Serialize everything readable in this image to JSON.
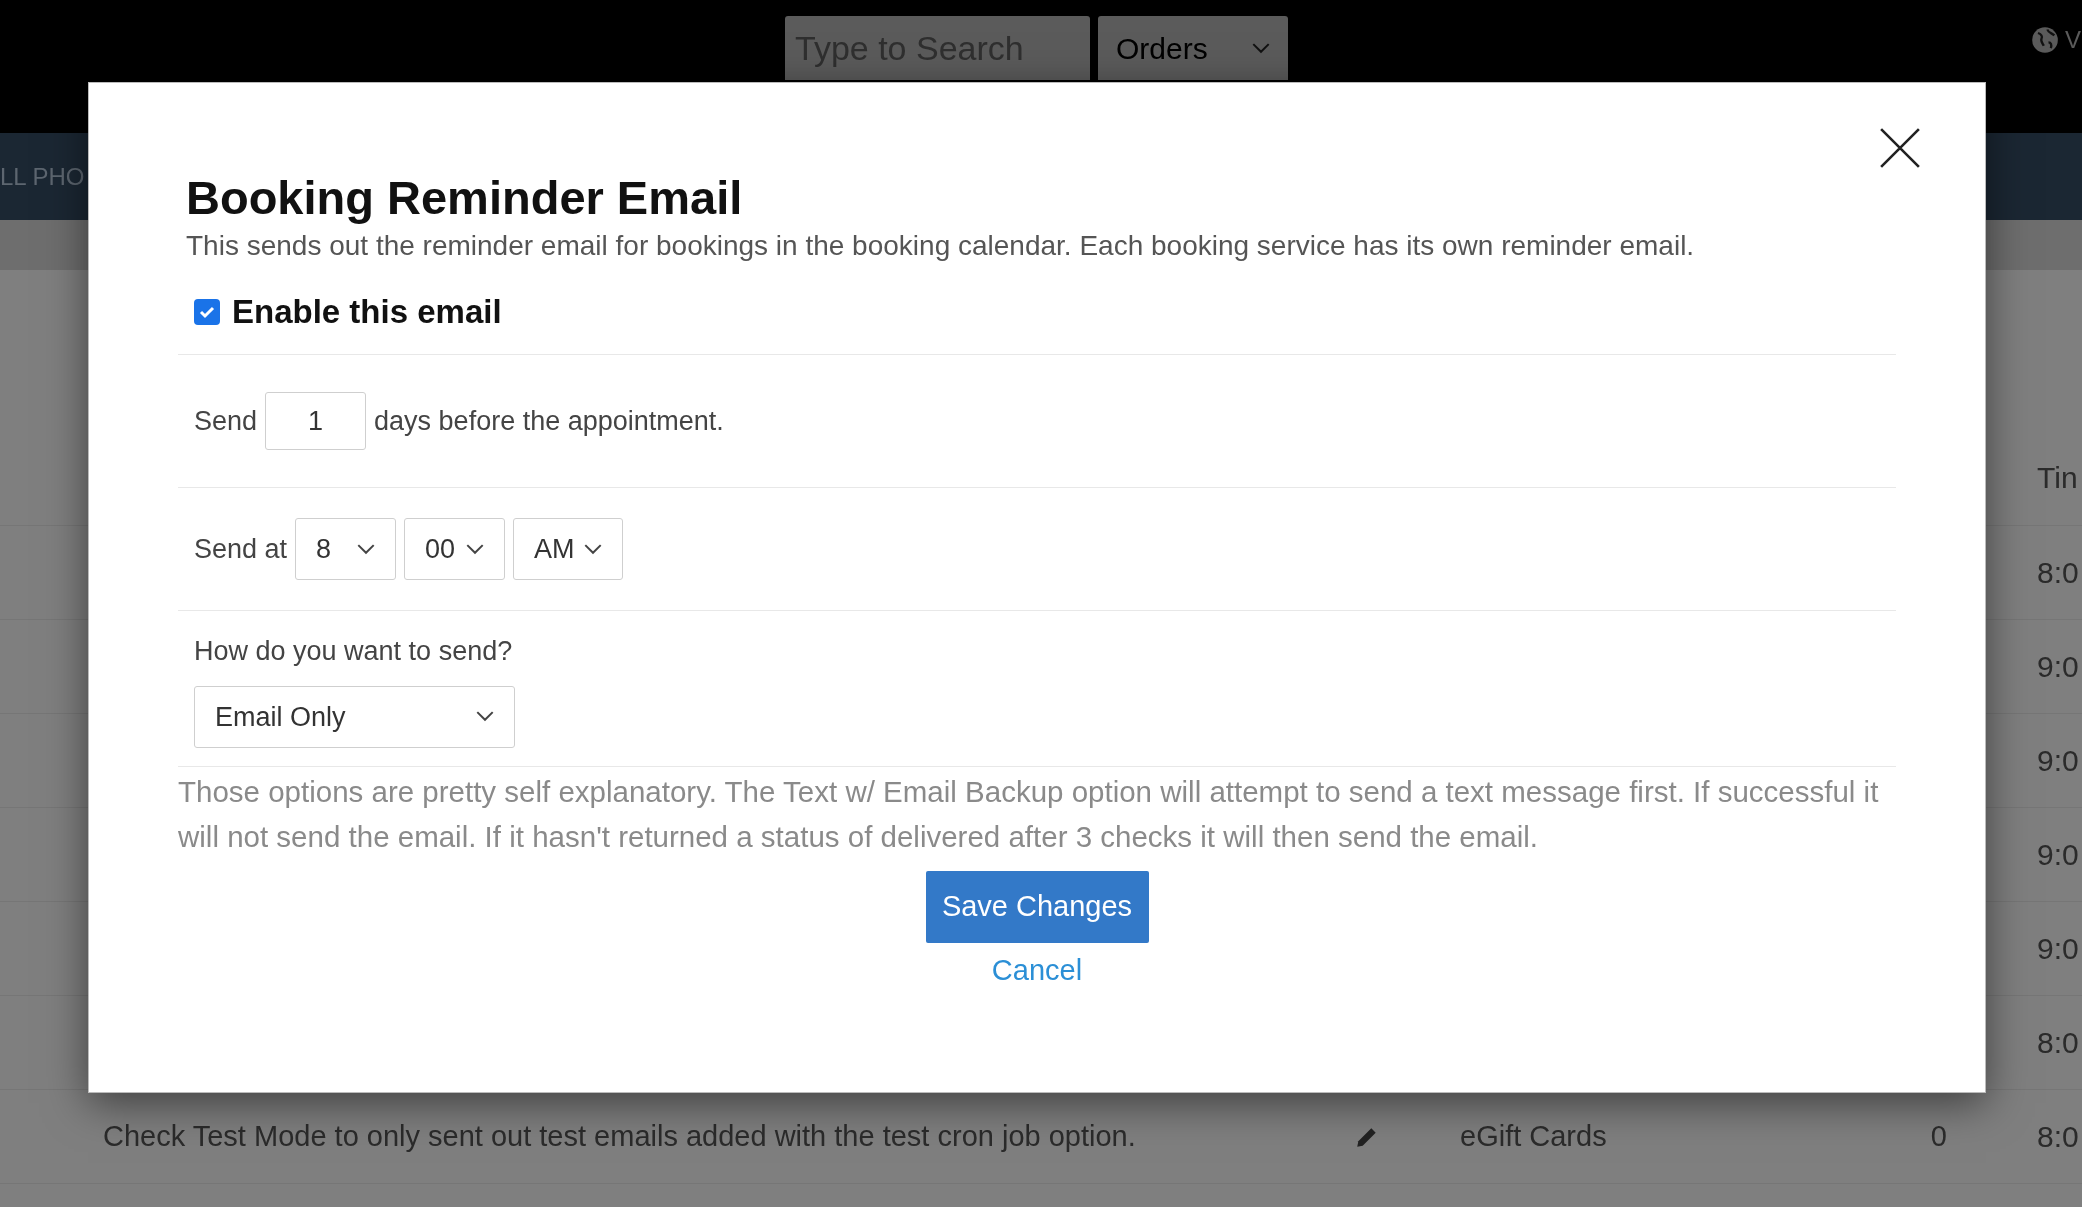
{
  "header": {
    "search": {
      "placeholder": "Type to Search"
    },
    "category_select": {
      "value": "Orders"
    },
    "corner_text": "V"
  },
  "nav": {
    "text": "LL PHO"
  },
  "table": {
    "column_header": "Tin",
    "rows": [
      {
        "time": "8:0"
      },
      {
        "time": "9:0"
      },
      {
        "time": "9:0"
      },
      {
        "time": "9:0"
      },
      {
        "time": "9:0"
      },
      {
        "time": "8:0"
      },
      {
        "description": "Check Test Mode to only sent out test emails added with the test cron job option.",
        "name": "eGift Cards",
        "count": "0",
        "time": "8:0"
      }
    ]
  },
  "modal": {
    "title": "Booking Reminder Email",
    "description": "This sends out the reminder email for bookings in the booking calendar. Each booking service has its own reminder email.",
    "enable": {
      "label": "Enable this email",
      "checked": true
    },
    "send_days": {
      "prefix": "Send",
      "value": "1",
      "suffix": "days before the appointment."
    },
    "send_at": {
      "label": "Send at",
      "hour": "8",
      "minute": "00",
      "period": "AM"
    },
    "send_method": {
      "label": "How do you want to send?",
      "value": "Email Only"
    },
    "help": "Those options are pretty self explanatory. The Text w/ Email Backup option will attempt to send a text message first. If successful it will not send the email. If it hasn't returned a status of delivered after 3 checks it will then send the email.",
    "save_button": "Save Changes",
    "cancel_link": "Cancel"
  }
}
